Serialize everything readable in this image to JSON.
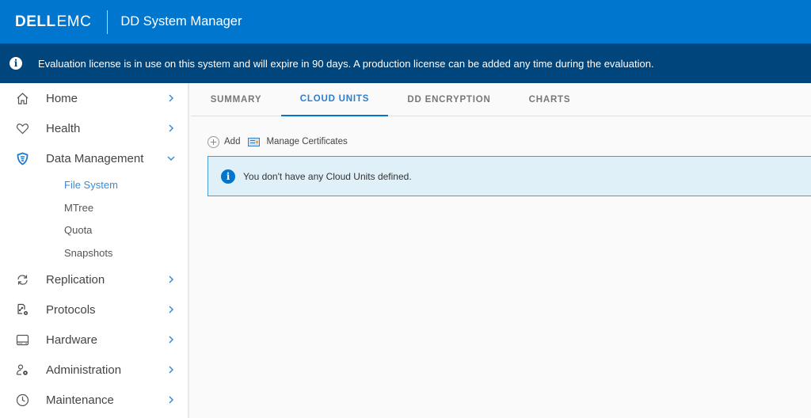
{
  "header": {
    "logo_dell": "DELL",
    "logo_emc": "EMC",
    "app_title": "DD System Manager",
    "brand_color": "#0076ce"
  },
  "banner": {
    "icon": "info-icon",
    "text": "Evaluation license is in use on this system and will expire in 90 days. A production license can be added any time during the evaluation."
  },
  "sidebar": {
    "items": [
      {
        "label": "Home",
        "icon": "home-icon",
        "expanded": false
      },
      {
        "label": "Health",
        "icon": "heart-icon",
        "expanded": false
      },
      {
        "label": "Data Management",
        "icon": "shield-icon",
        "expanded": true,
        "children": [
          {
            "label": "File System",
            "active": true
          },
          {
            "label": "MTree"
          },
          {
            "label": "Quota"
          },
          {
            "label": "Snapshots"
          }
        ]
      },
      {
        "label": "Replication",
        "icon": "sync-icon",
        "expanded": false
      },
      {
        "label": "Protocols",
        "icon": "protocols-icon",
        "expanded": false
      },
      {
        "label": "Hardware",
        "icon": "hard-drive-icon",
        "expanded": false
      },
      {
        "label": "Administration",
        "icon": "user-gear-icon",
        "expanded": false
      },
      {
        "label": "Maintenance",
        "icon": "clock-icon",
        "expanded": false
      }
    ]
  },
  "main": {
    "tabs": [
      {
        "label": "SUMMARY"
      },
      {
        "label": "CLOUD UNITS",
        "active": true
      },
      {
        "label": "DD ENCRYPTION"
      },
      {
        "label": "CHARTS"
      }
    ],
    "toolbar": {
      "add_label": "Add",
      "manage_certificates_label": "Manage Certificates"
    },
    "alert": {
      "text": "You don't have any Cloud Units defined."
    }
  }
}
